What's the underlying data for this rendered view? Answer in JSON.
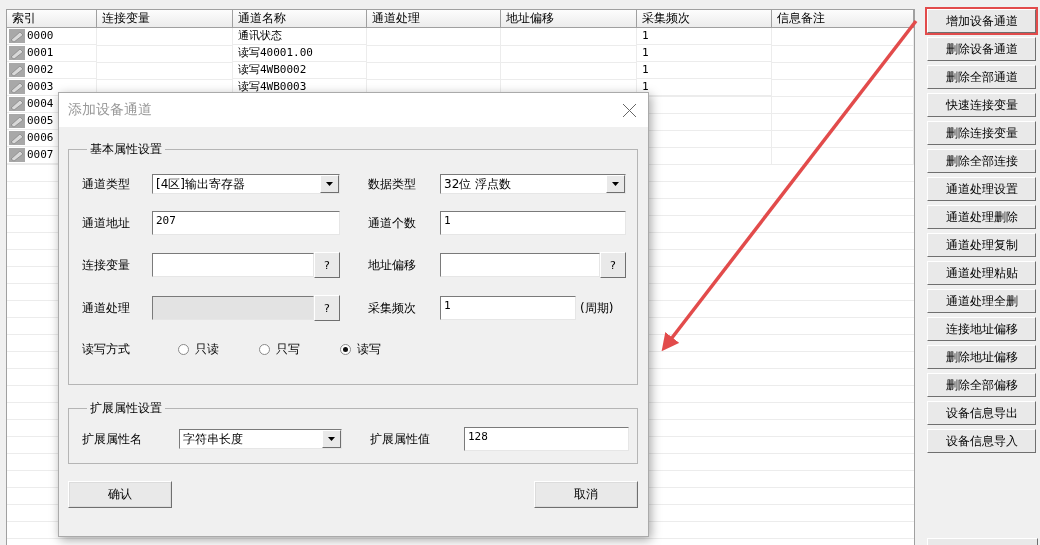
{
  "table": {
    "columns": [
      "索引",
      "连接变量",
      "通道名称",
      "通道处理",
      "地址偏移",
      "采集频次",
      "信息备注"
    ],
    "rows": [
      {
        "index": "0000",
        "channel_name": "通讯状态",
        "frequency": "1"
      },
      {
        "index": "0001",
        "channel_name": "读写40001.00",
        "frequency": "1"
      },
      {
        "index": "0002",
        "channel_name": "读写4WB0002",
        "frequency": "1"
      },
      {
        "index": "0003",
        "channel_name": "读写4WB0003",
        "frequency": "1"
      },
      {
        "index": "0004"
      },
      {
        "index": "0005"
      },
      {
        "index": "0006"
      },
      {
        "index": "0007"
      }
    ]
  },
  "side_buttons": [
    {
      "label": "增加设备通道",
      "highlighted": true
    },
    {
      "label": "删除设备通道",
      "highlighted": false
    },
    {
      "label": "删除全部通道",
      "highlighted": false
    },
    {
      "label": "快速连接变量",
      "highlighted": false
    },
    {
      "label": "删除连接变量",
      "highlighted": false
    },
    {
      "label": "删除全部连接",
      "highlighted": false
    },
    {
      "label": "通道处理设置",
      "highlighted": false
    },
    {
      "label": "通道处理删除",
      "highlighted": false
    },
    {
      "label": "通道处理复制",
      "highlighted": false
    },
    {
      "label": "通道处理粘贴",
      "highlighted": false
    },
    {
      "label": "通道处理全删",
      "highlighted": false
    },
    {
      "label": "连接地址偏移",
      "highlighted": false
    },
    {
      "label": "删除地址偏移",
      "highlighted": false
    },
    {
      "label": "删除全部偏移",
      "highlighted": false
    },
    {
      "label": "设备信息导出",
      "highlighted": false
    },
    {
      "label": "设备信息导入",
      "highlighted": false
    }
  ],
  "dialog": {
    "title": "添加设备通道",
    "basic_group": {
      "title": "基本属性设置",
      "fields": [
        {
          "label": "通道类型",
          "kind": "dropdown",
          "value": "[4区]输出寄存器"
        },
        {
          "label": "数据类型",
          "kind": "dropdown",
          "value": "32位 浮点数"
        },
        {
          "label": "通道地址",
          "kind": "text",
          "value": "207"
        },
        {
          "label": "通道个数",
          "kind": "text",
          "value": "1"
        },
        {
          "label": "连接变量",
          "kind": "lookup",
          "button": "?",
          "disabled": false
        },
        {
          "label": "地址偏移",
          "kind": "lookup",
          "button": "?",
          "disabled": false
        },
        {
          "label": "通道处理",
          "kind": "lookup",
          "button": "?",
          "disabled": true
        },
        {
          "label": "采集频次",
          "kind": "text",
          "value": "1",
          "suffix": "(周期)"
        }
      ],
      "read_write": {
        "label": "读写方式",
        "options": [
          {
            "label": "只读",
            "selected": false
          },
          {
            "label": "只写",
            "selected": false
          },
          {
            "label": "读写",
            "selected": true
          }
        ]
      }
    },
    "extended_group": {
      "title": "扩展属性设置",
      "name_label": "扩展属性名",
      "name_value": "字符串长度",
      "value_label": "扩展属性值",
      "value": "128"
    },
    "buttons": [
      "确认",
      "取消"
    ]
  }
}
